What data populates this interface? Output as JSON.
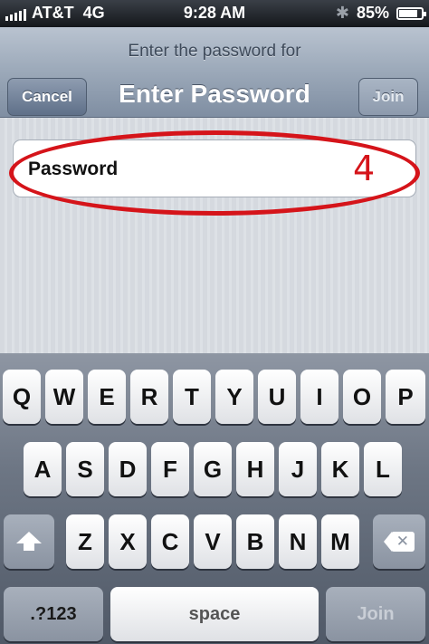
{
  "status_bar": {
    "carrier": "AT&T",
    "network": "4G",
    "time": "9:28 AM",
    "battery_percent": "85%",
    "battery_level": 0.85,
    "icons": [
      "signal-icon",
      "bluetooth-icon",
      "battery-icon"
    ]
  },
  "nav": {
    "prompt": "Enter the password for",
    "title": "Enter Password",
    "cancel_label": "Cancel",
    "join_label": "Join"
  },
  "form": {
    "password_label": "Password"
  },
  "annotation": {
    "number": "4",
    "color": "#d5141a"
  },
  "keyboard": {
    "row1": [
      "Q",
      "W",
      "E",
      "R",
      "T",
      "Y",
      "U",
      "I",
      "O",
      "P"
    ],
    "row2": [
      "A",
      "S",
      "D",
      "F",
      "G",
      "H",
      "J",
      "K",
      "L"
    ],
    "row3": [
      "Z",
      "X",
      "C",
      "V",
      "B",
      "N",
      "M"
    ],
    "numbers_label": ".?123",
    "space_label": "space",
    "join_label": "Join",
    "shift_icon": "shift-icon",
    "delete_icon": "delete-icon"
  }
}
